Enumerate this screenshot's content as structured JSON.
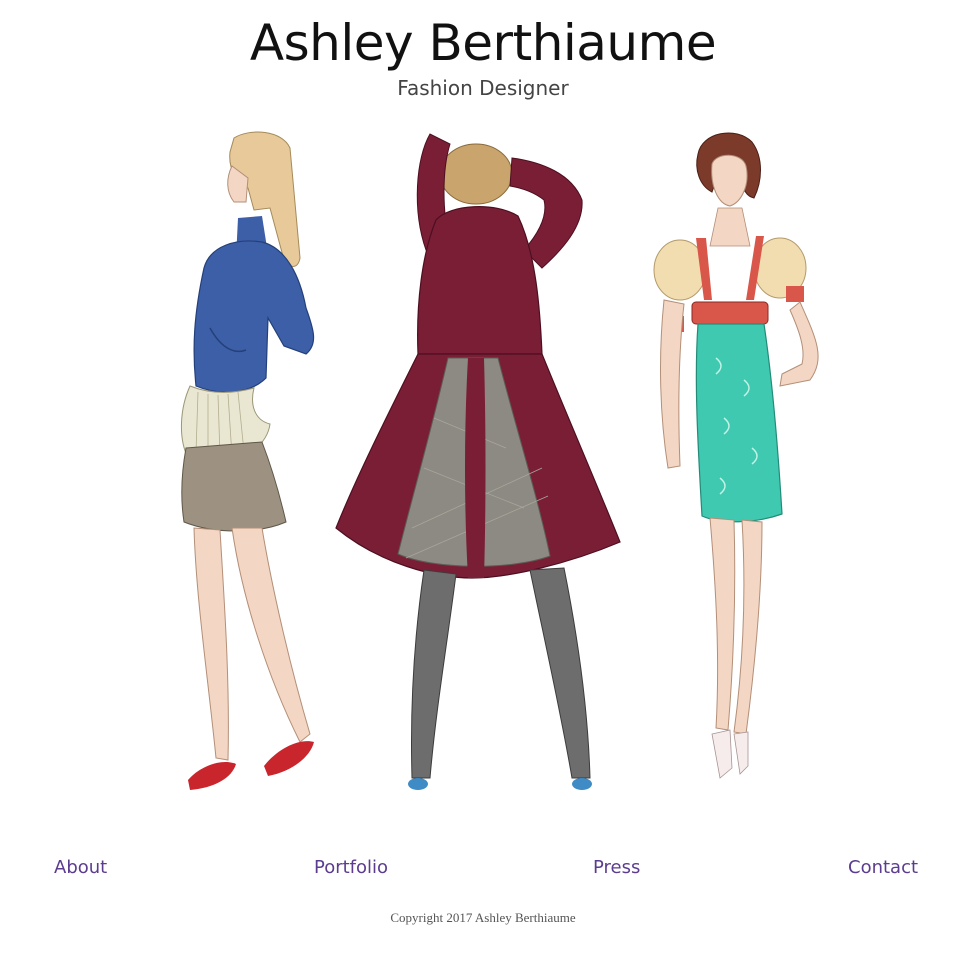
{
  "header": {
    "title": "Ashley Berthiaume",
    "subtitle": "Fashion Designer"
  },
  "hero": {
    "figures": [
      "figure-blue-sweater",
      "figure-burgundy-coat",
      "figure-teal-dress"
    ],
    "colors": {
      "blue": "#3d5fa8",
      "burgundy": "#7a1e36",
      "plaid": "#8c8a82",
      "teal": "#3fc9b0",
      "red": "#c8262c",
      "skin": "#f3d6c3"
    }
  },
  "nav": {
    "items": [
      {
        "label": "About"
      },
      {
        "label": "Portfolio"
      },
      {
        "label": "Press"
      },
      {
        "label": "Contact"
      }
    ],
    "link_color": "#5b3c8f"
  },
  "footer": {
    "copyright": "Copyright 2017 Ashley Berthiaume"
  }
}
